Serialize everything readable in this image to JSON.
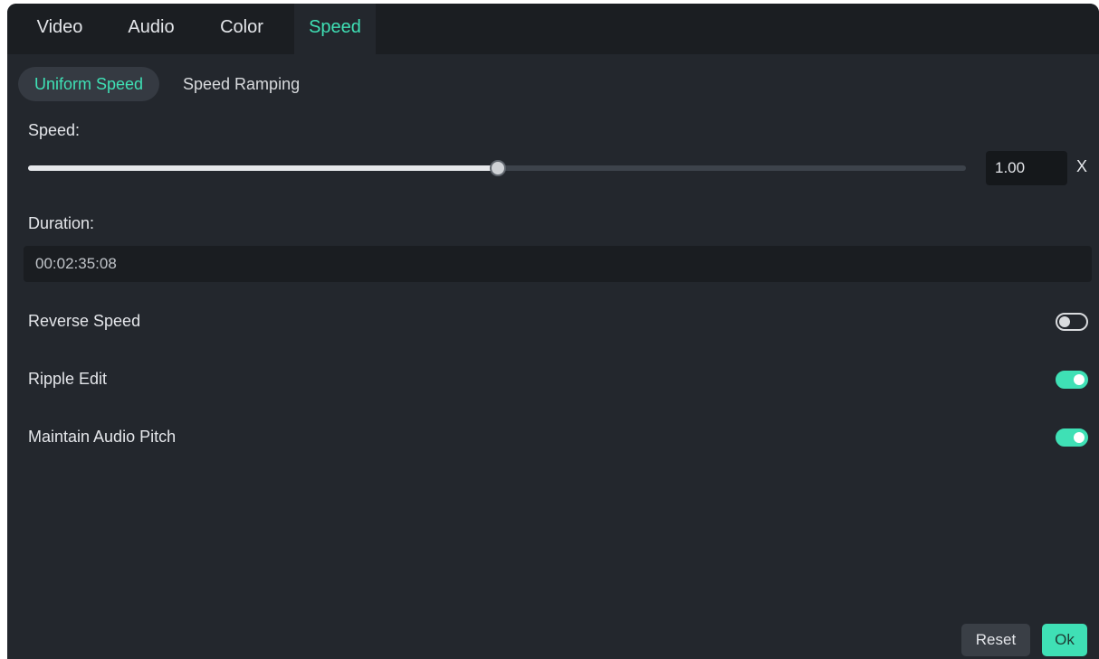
{
  "tabs": [
    {
      "label": "Video",
      "active": false
    },
    {
      "label": "Audio",
      "active": false
    },
    {
      "label": "Color",
      "active": false
    },
    {
      "label": "Speed",
      "active": true
    }
  ],
  "subtabs": [
    {
      "label": "Uniform Speed",
      "active": true
    },
    {
      "label": "Speed Ramping",
      "active": false
    }
  ],
  "speed": {
    "label": "Speed:",
    "slider_fraction": 0.5,
    "value": "1.00",
    "unit": "X"
  },
  "duration": {
    "label": "Duration:",
    "value": "00:02:35:08"
  },
  "options": [
    {
      "label": "Reverse Speed",
      "enabled": false
    },
    {
      "label": "Ripple Edit",
      "enabled": true
    },
    {
      "label": "Maintain Audio Pitch",
      "enabled": true
    }
  ],
  "buttons": {
    "reset": "Reset",
    "ok": "Ok"
  },
  "colors": {
    "accent": "#3fe0b5",
    "background": "#23272d",
    "tabbar": "#1b1e22"
  }
}
